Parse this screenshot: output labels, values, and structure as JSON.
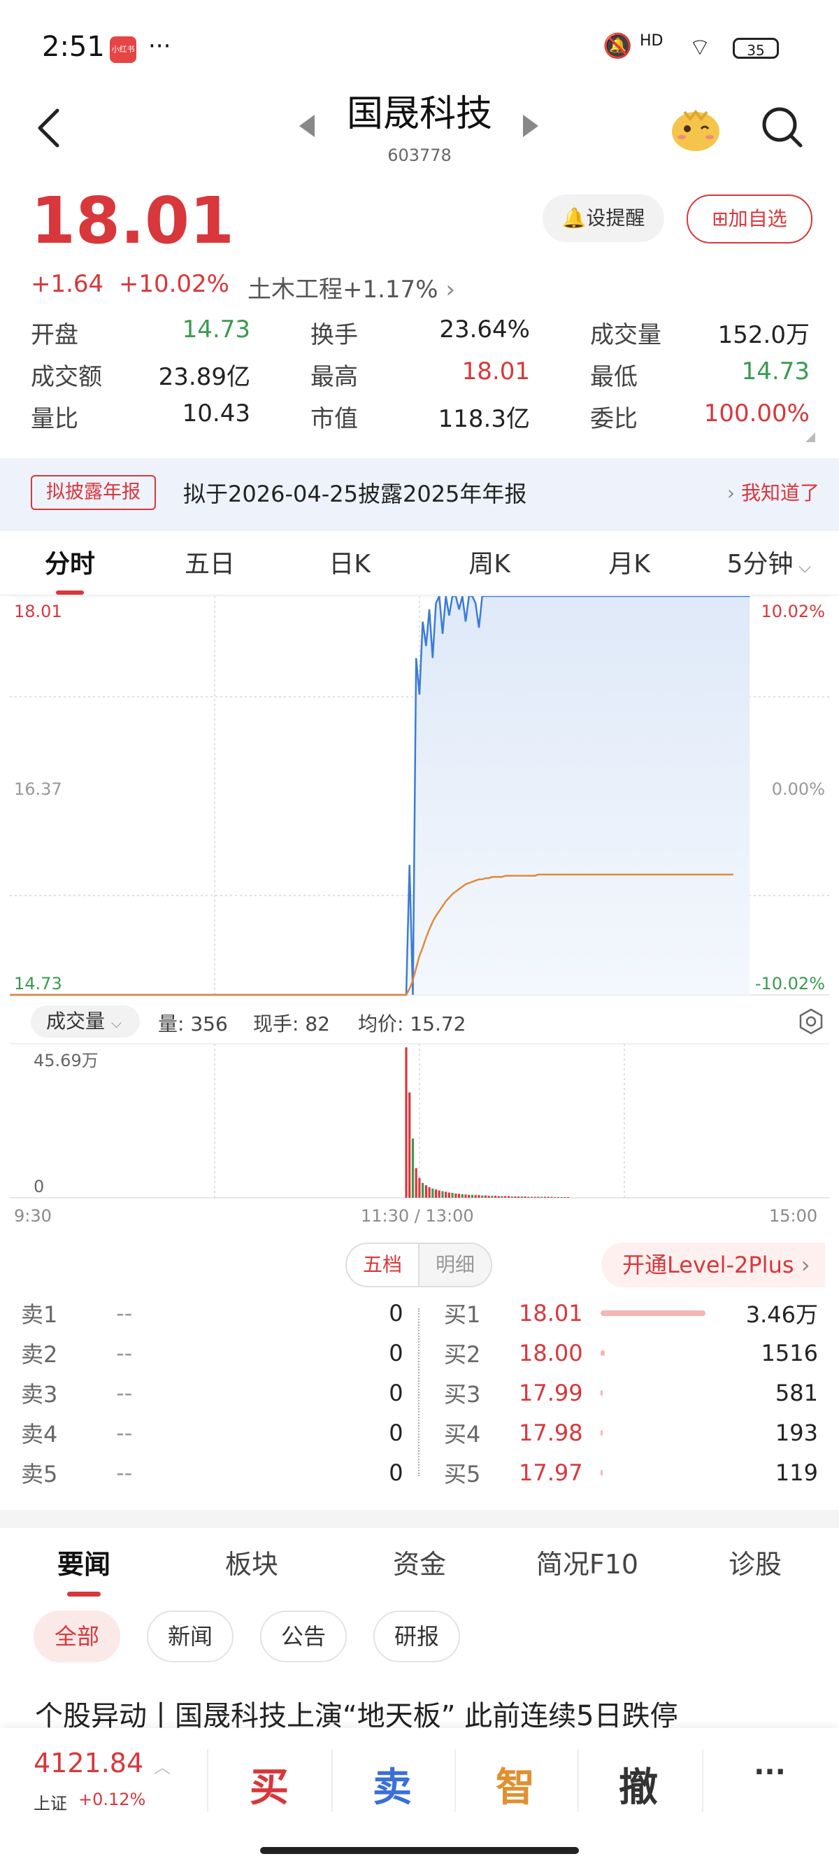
{
  "status_bar": {
    "time": "2:51",
    "app_badge": "小红书",
    "more": "···",
    "signal": "HD",
    "battery": "35"
  },
  "header": {
    "title": "国晟科技",
    "code": "603778"
  },
  "quote": {
    "price": "18.01",
    "change": "+1.64",
    "change_pct": "+10.02%",
    "sector": "土木工程+1.17%",
    "alert_label": "设提醒",
    "add_label": "加自选",
    "stats": [
      [
        {
          "label": "开盘",
          "value": "14.73",
          "tone": "green"
        },
        {
          "label": "换手",
          "value": "23.64%",
          "tone": "dark"
        },
        {
          "label": "成交量",
          "value": "152.0万",
          "tone": "dark"
        }
      ],
      [
        {
          "label": "成交额",
          "value": "23.89亿",
          "tone": "dark"
        },
        {
          "label": "最高",
          "value": "18.01",
          "tone": "red"
        },
        {
          "label": "最低",
          "value": "14.73",
          "tone": "green"
        }
      ],
      [
        {
          "label": "量比",
          "value": "10.43",
          "tone": "dark"
        },
        {
          "label": "市值",
          "value": "118.3亿",
          "tone": "dark"
        },
        {
          "label": "委比",
          "value": "100.00%",
          "tone": "red"
        }
      ]
    ]
  },
  "notice": {
    "tag": "拟披露年报",
    "text": "拟于2026-04-25披露2025年年报",
    "action": "我知道了"
  },
  "chart_tabs": [
    "分时",
    "五日",
    "日K",
    "周K",
    "月K",
    "5分钟"
  ],
  "chart_data": {
    "type": "line",
    "y_left_labels": [
      "18.01",
      "16.37",
      "14.73"
    ],
    "y_right_labels": [
      "10.02%",
      "0.00%",
      "-10.02%"
    ],
    "ylim": [
      14.73,
      18.01
    ],
    "x_labels": [
      "9:30",
      "11:30 / 13:00",
      "15:00"
    ],
    "colors": {
      "price": "#3b7bd8",
      "avg": "#e08a3a"
    },
    "series": [
      {
        "values": [
          14.73,
          14.73,
          14.73,
          14.73,
          14.73,
          14.73,
          14.73,
          14.73,
          14.73,
          14.73,
          14.73,
          14.73,
          14.73,
          14.73,
          14.73,
          14.73,
          14.73,
          14.73,
          14.73,
          14.73,
          14.73,
          14.73,
          14.73,
          14.73,
          14.73,
          14.73,
          14.73,
          14.73,
          14.73,
          14.73,
          14.73,
          14.73,
          14.73,
          14.73,
          14.73,
          14.73,
          14.73,
          14.73,
          14.73,
          14.73,
          14.73,
          14.73,
          14.73,
          14.73,
          14.73,
          14.73,
          14.73,
          14.73,
          14.73,
          14.73,
          14.73,
          14.73,
          14.73,
          14.73,
          14.73,
          14.73,
          14.73,
          14.73,
          14.73,
          14.73,
          14.73,
          14.73,
          14.73,
          14.73,
          14.73,
          14.73,
          14.73,
          14.73,
          14.73,
          14.73,
          14.73,
          14.73,
          14.73,
          14.73,
          14.73,
          14.73,
          14.73,
          14.73,
          14.73,
          14.73,
          14.73,
          14.73,
          14.73,
          14.73,
          14.73,
          14.73,
          14.73,
          14.73,
          14.73,
          14.73,
          14.73,
          14.73,
          14.73,
          14.73,
          14.73,
          14.73,
          14.73,
          14.73,
          14.73,
          14.73,
          14.73,
          14.73,
          14.73,
          14.73,
          14.73,
          14.73,
          14.73,
          14.73,
          14.73,
          14.73,
          14.73,
          14.73,
          14.73,
          14.73,
          14.73,
          14.73,
          14.73,
          14.73,
          14.73,
          14.73,
          14.73,
          15.8,
          14.73,
          17.5,
          17.2,
          17.8,
          17.6,
          17.9,
          17.5,
          17.95,
          18.01,
          17.7,
          18.01,
          17.85,
          18.01,
          18.01,
          17.9,
          18.01,
          17.8,
          18.01,
          18.01,
          17.95,
          17.75,
          18.01,
          18.01,
          18.01,
          18.01,
          18.01,
          18.01,
          18.01,
          18.01,
          18.01,
          18.01,
          18.01,
          18.01,
          18.01,
          18.01,
          18.01,
          18.01,
          18.01,
          18.01,
          18.01,
          18.01,
          18.01,
          18.01,
          18.01,
          18.01,
          18.01,
          18.01,
          18.01,
          18.01,
          18.01,
          18.01,
          18.01,
          18.01,
          18.01,
          18.01,
          18.01,
          18.01,
          18.01,
          18.01,
          18.01,
          18.01,
          18.01,
          18.01,
          18.01,
          18.01,
          18.01,
          18.01,
          18.01,
          18.01,
          18.01,
          18.01,
          18.01,
          18.01,
          18.01,
          18.01,
          18.01,
          18.01,
          18.01,
          18.01,
          18.01,
          18.01,
          18.01,
          18.01,
          18.01,
          18.01,
          18.01,
          18.01,
          18.01,
          18.01,
          18.01,
          18.01,
          18.01,
          18.01,
          18.01,
          18.01,
          18.01,
          18.01,
          18.01,
          18.01,
          18.01,
          18.01,
          18.01,
          18.01
        ]
      },
      {
        "values": [
          14.73,
          14.73,
          14.73,
          14.73,
          14.73,
          14.73,
          14.73,
          14.73,
          14.73,
          14.73,
          14.73,
          14.73,
          14.73,
          14.73,
          14.73,
          14.73,
          14.73,
          14.73,
          14.73,
          14.73,
          14.73,
          14.73,
          14.73,
          14.73,
          14.73,
          14.73,
          14.73,
          14.73,
          14.73,
          14.73,
          14.73,
          14.73,
          14.73,
          14.73,
          14.73,
          14.73,
          14.73,
          14.73,
          14.73,
          14.73,
          14.73,
          14.73,
          14.73,
          14.73,
          14.73,
          14.73,
          14.73,
          14.73,
          14.73,
          14.73,
          14.73,
          14.73,
          14.73,
          14.73,
          14.73,
          14.73,
          14.73,
          14.73,
          14.73,
          14.73,
          14.73,
          14.73,
          14.73,
          14.73,
          14.73,
          14.73,
          14.73,
          14.73,
          14.73,
          14.73,
          14.73,
          14.73,
          14.73,
          14.73,
          14.73,
          14.73,
          14.73,
          14.73,
          14.73,
          14.73,
          14.73,
          14.73,
          14.73,
          14.73,
          14.73,
          14.73,
          14.73,
          14.73,
          14.73,
          14.73,
          14.73,
          14.73,
          14.73,
          14.73,
          14.73,
          14.73,
          14.73,
          14.73,
          14.73,
          14.73,
          14.73,
          14.73,
          14.73,
          14.73,
          14.73,
          14.73,
          14.73,
          14.73,
          14.73,
          14.73,
          14.73,
          14.73,
          14.73,
          14.73,
          14.73,
          14.73,
          14.73,
          14.73,
          14.73,
          14.73,
          14.73,
          14.78,
          14.85,
          14.95,
          15.05,
          15.12,
          15.2,
          15.27,
          15.33,
          15.38,
          15.42,
          15.46,
          15.5,
          15.53,
          15.56,
          15.58,
          15.6,
          15.62,
          15.64,
          15.65,
          15.66,
          15.67,
          15.68,
          15.68,
          15.69,
          15.69,
          15.7,
          15.7,
          15.7,
          15.7,
          15.71,
          15.71,
          15.71,
          15.71,
          15.71,
          15.71,
          15.71,
          15.71,
          15.71,
          15.71,
          15.72,
          15.72,
          15.72,
          15.72,
          15.72,
          15.72,
          15.72,
          15.72,
          15.72,
          15.72,
          15.72,
          15.72,
          15.72,
          15.72,
          15.72,
          15.72,
          15.72,
          15.72,
          15.72,
          15.72,
          15.72,
          15.72,
          15.72,
          15.72,
          15.72,
          15.72,
          15.72,
          15.72,
          15.72,
          15.72,
          15.72,
          15.72,
          15.72,
          15.72,
          15.72,
          15.72,
          15.72,
          15.72,
          15.72,
          15.72,
          15.72,
          15.72,
          15.72,
          15.72,
          15.72,
          15.72,
          15.72,
          15.72,
          15.72,
          15.72,
          15.72,
          15.72,
          15.72,
          15.72,
          15.72,
          15.72,
          15.72,
          15.72,
          15.72,
          15.72
        ]
      }
    ],
    "volume": {
      "label": "成交量",
      "info": [
        "量: 356",
        "现手: 82",
        "均价: 15.72"
      ],
      "max_label": "45.69万",
      "zero_label": "0",
      "ylim": [
        0,
        45.69
      ],
      "values": [
        45.69,
        32,
        18,
        9,
        6,
        4.5,
        3.8,
        3.2,
        2.8,
        2.5,
        2.2,
        2.0,
        1.8,
        1.6,
        1.5,
        1.3,
        1.2,
        1.1,
        1.0,
        0.9,
        0.9,
        0.8,
        0.8,
        0.7,
        0.7,
        0.6,
        0.6,
        0.6,
        0.5,
        0.5,
        0.5,
        0.5,
        0.4,
        0.4,
        0.4,
        0.4,
        0.4,
        0.3,
        0.3,
        0.3,
        0.3,
        0.3,
        0.3,
        0.3,
        0.3,
        0.2,
        0.2,
        0.2,
        0.2,
        0.2
      ]
    }
  },
  "order_book": {
    "toggle": [
      "五档",
      "明细"
    ],
    "level2": "开通Level-2Plus",
    "asks": [
      {
        "label": "卖1",
        "price": "--",
        "vol": "0"
      },
      {
        "label": "卖2",
        "price": "--",
        "vol": "0"
      },
      {
        "label": "卖3",
        "price": "--",
        "vol": "0"
      },
      {
        "label": "卖4",
        "price": "--",
        "vol": "0"
      },
      {
        "label": "卖5",
        "price": "--",
        "vol": "0"
      }
    ],
    "bids": [
      {
        "label": "买1",
        "price": "18.01",
        "vol": "3.46万",
        "bar": 1.0
      },
      {
        "label": "买2",
        "price": "18.00",
        "vol": "1516",
        "bar": 0.044
      },
      {
        "label": "买3",
        "price": "17.99",
        "vol": "581",
        "bar": 0.017
      },
      {
        "label": "买4",
        "price": "17.98",
        "vol": "193",
        "bar": 0.006
      },
      {
        "label": "买5",
        "price": "17.97",
        "vol": "119",
        "bar": 0.003
      }
    ]
  },
  "news": {
    "tabs": [
      "要闻",
      "板块",
      "资金",
      "简况F10",
      "诊股"
    ],
    "filters": [
      "全部",
      "新闻",
      "公告",
      "研报"
    ],
    "headline": "个股异动丨国晟科技上演“地天板” 此前连续5日跌停"
  },
  "bottom_bar": {
    "index_value": "4121.84",
    "index_name": "上证",
    "index_change": "+0.12%",
    "actions": [
      "买",
      "卖",
      "智",
      "撤",
      "···"
    ],
    "action_colors": [
      "#d8373b",
      "#3b6fd8",
      "#e0902e",
      "#333333",
      "#333333"
    ]
  }
}
